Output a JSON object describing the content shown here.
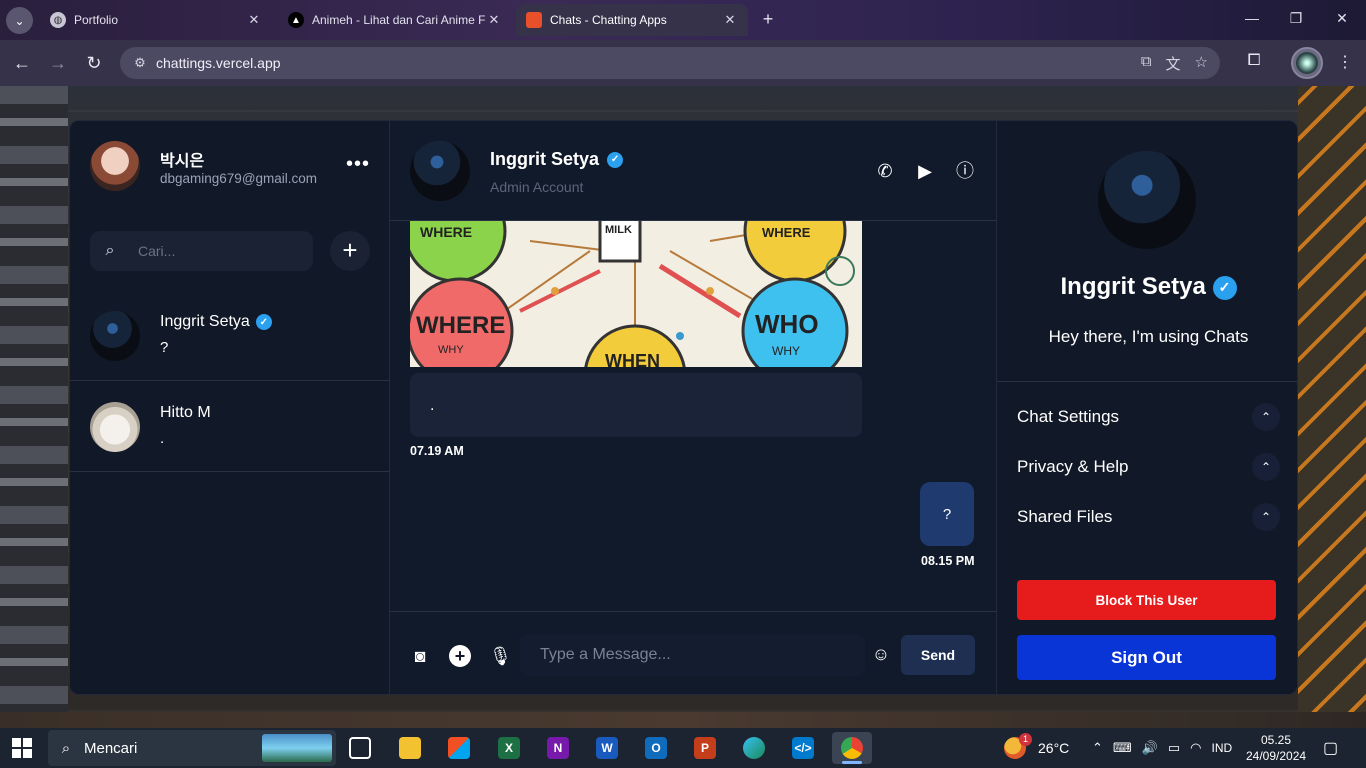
{
  "browser": {
    "tabs": [
      {
        "title": "Portfolio",
        "active": false
      },
      {
        "title": "Animeh - Lihat dan Cari Anime F",
        "active": false
      },
      {
        "title": "Chats - Chatting Apps",
        "active": true
      }
    ],
    "url": "chattings.vercel.app"
  },
  "sidebar": {
    "me": {
      "name": "박시은",
      "email": "dbgaming679@gmail.com"
    },
    "search": {
      "placeholder": "Cari..."
    },
    "contacts": [
      {
        "name": "Inggrit Setya",
        "verified": true,
        "last_message": "?"
      },
      {
        "name": "Hitto M",
        "verified": false,
        "last_message": "."
      }
    ]
  },
  "chat": {
    "header": {
      "name": "Inggrit Setya",
      "subtitle": "Admin Account"
    },
    "image_labels": [
      "WHERE",
      "MILK",
      "WHERE",
      "WHERE",
      "WHO",
      "WHEN",
      "WHY",
      "WHY"
    ],
    "messages": [
      {
        "side": "left",
        "text": ".",
        "time": "07.19 AM"
      },
      {
        "side": "right",
        "text": "?",
        "time": "08.15 PM"
      }
    ],
    "composer": {
      "placeholder": "Type a Message...",
      "send_label": "Send"
    }
  },
  "profile": {
    "name": "Inggrit Setya",
    "status": "Hey there, I'm using Chats",
    "sections": [
      "Chat Settings",
      "Privacy & Help",
      "Shared Files"
    ],
    "block_label": "Block This User",
    "signout_label": "Sign Out"
  },
  "taskbar": {
    "search_text": "Mencari",
    "weather": "26°C",
    "language": "IND",
    "time": "05.25",
    "date": "24/09/2024",
    "notification_count": "1"
  },
  "colors": {
    "block": "#e61b1b",
    "signout": "#0a35d6",
    "verified": "#2aa0ef"
  }
}
